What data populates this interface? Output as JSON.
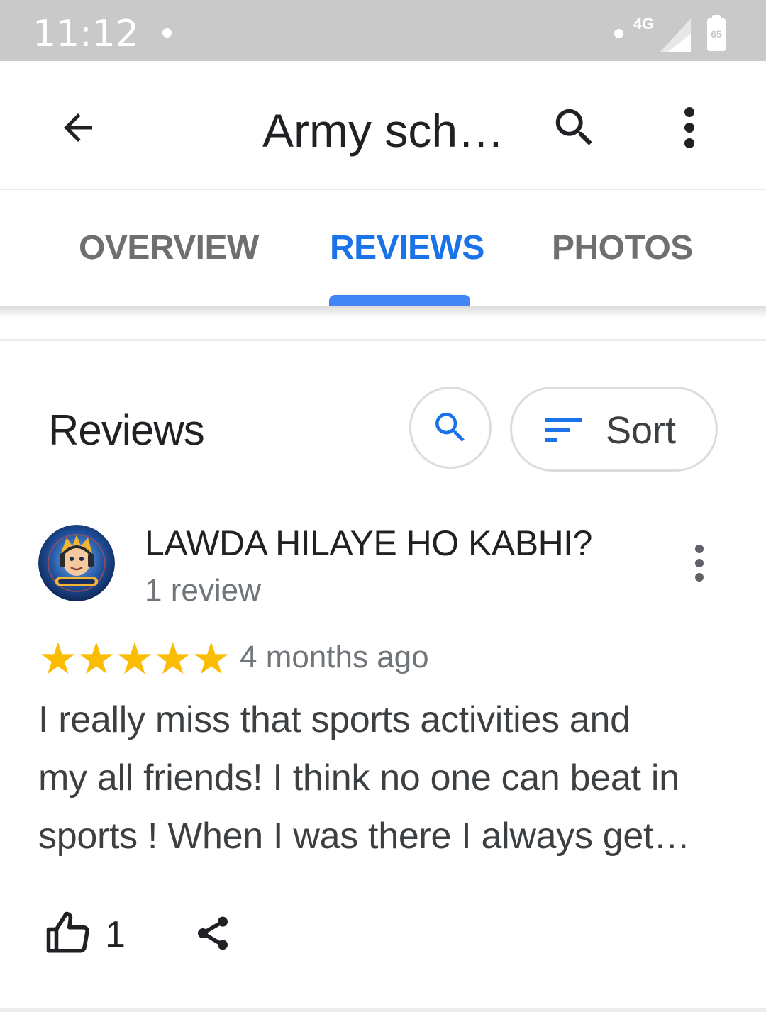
{
  "status_bar": {
    "time": "11:12",
    "network": "4G",
    "battery": "65"
  },
  "app_bar": {
    "title": "Army sch…"
  },
  "tabs": [
    {
      "label": "OVERVIEW",
      "active": false
    },
    {
      "label": "REVIEWS",
      "active": true
    },
    {
      "label": "PHOTOS",
      "active": false
    }
  ],
  "reviews_section": {
    "heading": "Reviews",
    "sort_label": "Sort"
  },
  "review": {
    "reviewer_name": "LAWDA HILAYE HO KABHI?",
    "reviewer_meta": "1 review",
    "rating": 5,
    "time_ago": "4 months ago",
    "text_lines": [
      "I really miss that sports activities and",
      "my all friends! I think no one can beat in",
      "sports ! When I was there I always get…"
    ],
    "like_count": "1"
  },
  "colors": {
    "accent": "#1a73e8",
    "tab_indicator": "#4285f4",
    "star": "#fbbc04",
    "status_bar": "#c9c9c9"
  },
  "icons": [
    "back-arrow-icon",
    "search-icon",
    "more-vert-icon",
    "sort-icon",
    "thumb-up-icon",
    "share-icon"
  ]
}
